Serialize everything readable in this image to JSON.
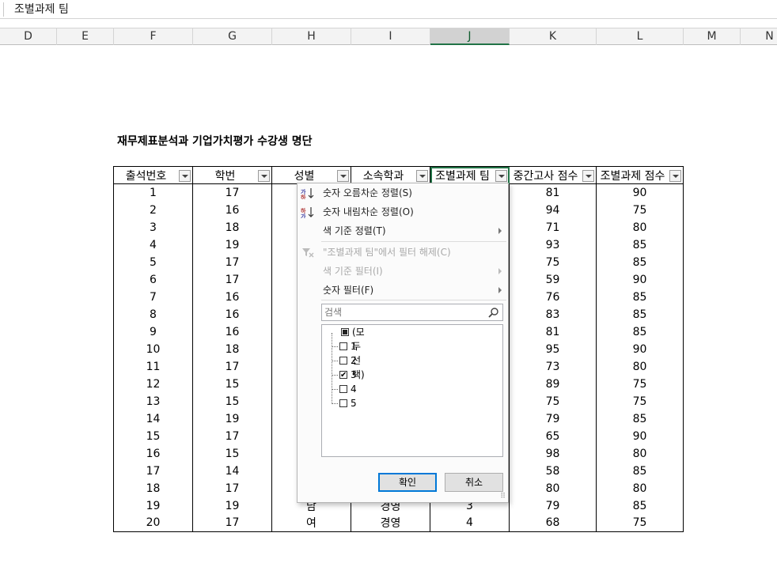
{
  "formula_bar": {
    "value": "조별과제 팀"
  },
  "columns": [
    "D",
    "E",
    "F",
    "G",
    "H",
    "I",
    "J",
    "K",
    "L",
    "M",
    "N"
  ],
  "selected_column": "J",
  "sheet_title": "재무제표분석과 기업가치평가 수강생 명단",
  "table": {
    "headers": [
      "출석번호",
      "학번",
      "성별",
      "소속학과",
      "조별과제 팀",
      "중간고사 점수",
      "조별과제 점수"
    ],
    "rows": [
      [
        "1",
        "17",
        "",
        "",
        "",
        "81",
        "90"
      ],
      [
        "2",
        "16",
        "",
        "",
        "",
        "94",
        "75"
      ],
      [
        "3",
        "18",
        "",
        "",
        "",
        "71",
        "80"
      ],
      [
        "4",
        "19",
        "",
        "",
        "",
        "93",
        "85"
      ],
      [
        "5",
        "17",
        "",
        "",
        "",
        "75",
        "85"
      ],
      [
        "6",
        "17",
        "",
        "",
        "",
        "59",
        "90"
      ],
      [
        "7",
        "16",
        "",
        "",
        "",
        "76",
        "85"
      ],
      [
        "8",
        "16",
        "",
        "",
        "",
        "83",
        "85"
      ],
      [
        "9",
        "16",
        "",
        "",
        "",
        "81",
        "85"
      ],
      [
        "10",
        "18",
        "",
        "",
        "",
        "95",
        "90"
      ],
      [
        "11",
        "17",
        "",
        "",
        "",
        "73",
        "80"
      ],
      [
        "12",
        "15",
        "",
        "",
        "",
        "89",
        "75"
      ],
      [
        "13",
        "15",
        "",
        "",
        "",
        "75",
        "75"
      ],
      [
        "14",
        "19",
        "",
        "",
        "",
        "79",
        "85"
      ],
      [
        "15",
        "17",
        "",
        "",
        "",
        "65",
        "90"
      ],
      [
        "16",
        "15",
        "",
        "",
        "",
        "98",
        "80"
      ],
      [
        "17",
        "14",
        "",
        "",
        "",
        "58",
        "85"
      ],
      [
        "18",
        "17",
        "",
        "",
        "",
        "80",
        "80"
      ],
      [
        "19",
        "19",
        "남",
        "경영",
        "3",
        "79",
        "85"
      ],
      [
        "20",
        "17",
        "여",
        "경영",
        "4",
        "68",
        "75"
      ]
    ]
  },
  "filter_menu": {
    "sort_asc": "숫자 오름차순 정렬(S)",
    "sort_desc": "숫자 내림차순 정렬(O)",
    "sort_by_color": "색 기준 정렬(T)",
    "clear_filter": "\"조별과제 팀\"에서 필터 해제(C)",
    "filter_by_color": "색 기준 필터(I)",
    "number_filters": "숫자 필터(F)",
    "search_placeholder": "검색",
    "select_all": "(모두 선택)",
    "items": [
      {
        "label": "1",
        "checked": false
      },
      {
        "label": "2",
        "checked": false
      },
      {
        "label": "3",
        "checked": true
      },
      {
        "label": "4",
        "checked": false
      },
      {
        "label": "5",
        "checked": false
      }
    ],
    "ok_label": "확인",
    "cancel_label": "취소"
  },
  "colors": {
    "accent": "#217346",
    "focus": "#0078d7"
  }
}
